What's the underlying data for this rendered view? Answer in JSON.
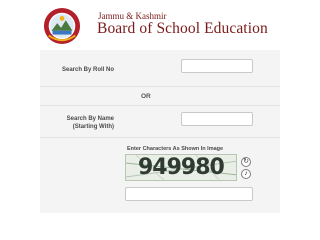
{
  "header": {
    "org_line1": "Jammu & Kashmir",
    "org_line2": "Board of School Education",
    "logo_icon": "jkbose-emblem-icon"
  },
  "form": {
    "roll_no_label": "Search By Roll No",
    "roll_no_value": "",
    "or_text": "OR",
    "name_label_line1": "Search By Name",
    "name_label_line2": "(Starting With)",
    "name_value": "",
    "captcha_label": "Enter Characters As Shown In Image",
    "captcha_text": "949980",
    "captcha_value": "",
    "refresh_icon": "refresh-icon",
    "audio_icon": "audio-icon"
  },
  "colors": {
    "brand": "#7a1a1a",
    "form_bg": "#f4f4f5"
  }
}
